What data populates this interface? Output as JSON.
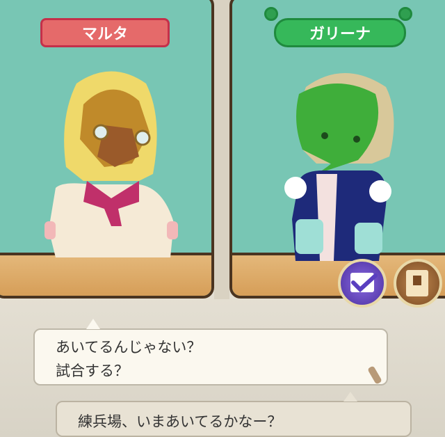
{
  "characters": {
    "left": {
      "name": "マルタ"
    },
    "right": {
      "name": "ガリーナ"
    }
  },
  "buttons": {
    "confirm": {
      "icon": "checkmark-icon",
      "color": "#6a4fc0"
    },
    "menu": {
      "icon": "book-icon",
      "color": "#8a5a2b"
    }
  },
  "dialogue": {
    "speech_line1": "あいてるんじゃない？",
    "speech_line2": "試合する？",
    "choice": "練兵場、いまあいてるかなー？"
  },
  "colors": {
    "panel_bg": "#78c6b4",
    "frame": "#4a3420",
    "name_left": "#e56a6a",
    "name_right": "#36b85a"
  }
}
